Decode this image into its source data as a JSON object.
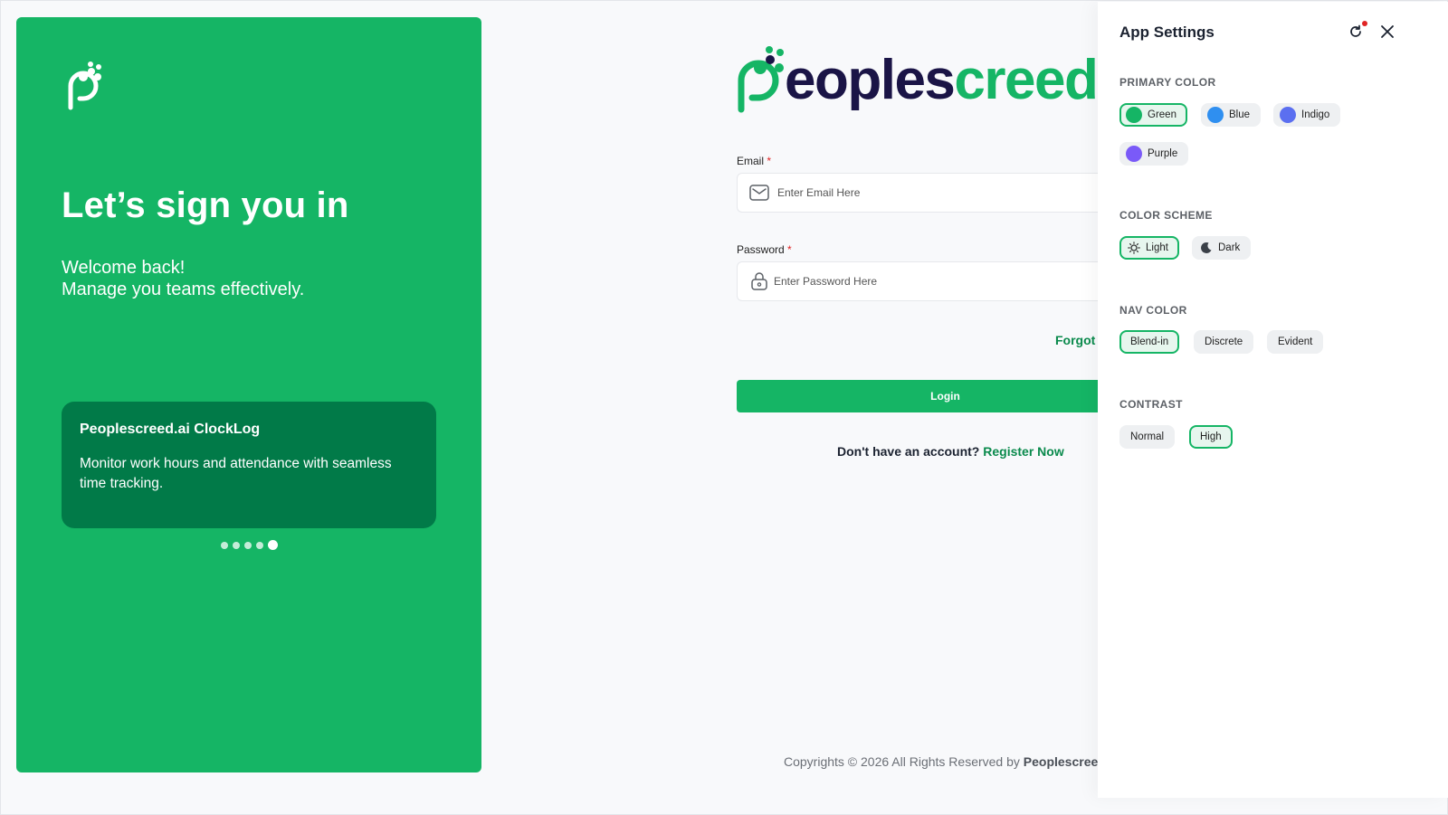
{
  "hero": {
    "logo_icon": "peoplescreed-mark-icon",
    "title": "Let’s sign you in",
    "welcome": "Welcome back!",
    "tagline": "Manage you teams effectively.",
    "card_title": "Peoplescreed.ai ClockLog",
    "card_body": "Monitor work hours and attendance with seamless time tracking.",
    "carousel_count": 5,
    "carousel_active": 5
  },
  "brand": {
    "name": "Peoplescreed"
  },
  "form": {
    "email_label": "Email",
    "email_placeholder": "Enter Email Here",
    "email_value": "",
    "password_label": "Password",
    "password_placeholder": "Enter Password Here",
    "password_value": "",
    "required_mark": "*",
    "forgot_label": "Forgot",
    "login_label": "Login",
    "no_account_text": "Don't have an account?",
    "register_label": "Register Now"
  },
  "footer": {
    "text": "Copyrights © 2026 All Rights Reserved by",
    "brand": "Peoplescreed."
  },
  "settings": {
    "title": "App Settings",
    "primary_color": {
      "title": "PRIMARY COLOR",
      "options": [
        {
          "label": "Green",
          "color": "#15b565",
          "selected": true
        },
        {
          "label": "Blue",
          "color": "#2f8ff0",
          "selected": false
        },
        {
          "label": "Indigo",
          "color": "#5b6ff0",
          "selected": false
        },
        {
          "label": "Purple",
          "color": "#7a5af8",
          "selected": false
        }
      ]
    },
    "color_scheme": {
      "title": "COLOR SCHEME",
      "options": [
        {
          "label": "Light",
          "icon": "sun-icon",
          "selected": true
        },
        {
          "label": "Dark",
          "icon": "moon-icon",
          "selected": false
        }
      ]
    },
    "nav_color": {
      "title": "NAV COLOR",
      "options": [
        {
          "label": "Blend-in",
          "selected": true
        },
        {
          "label": "Discrete",
          "selected": false
        },
        {
          "label": "Evident",
          "selected": false
        }
      ]
    },
    "contrast": {
      "title": "CONTRAST",
      "options": [
        {
          "label": "Normal",
          "selected": false
        },
        {
          "label": "High",
          "selected": true
        }
      ]
    }
  },
  "colors": {
    "primary": "#15b565",
    "card": "#017a48",
    "link": "#0a8a4c",
    "brand_dark": "#1a1446",
    "required": "#e02424"
  }
}
